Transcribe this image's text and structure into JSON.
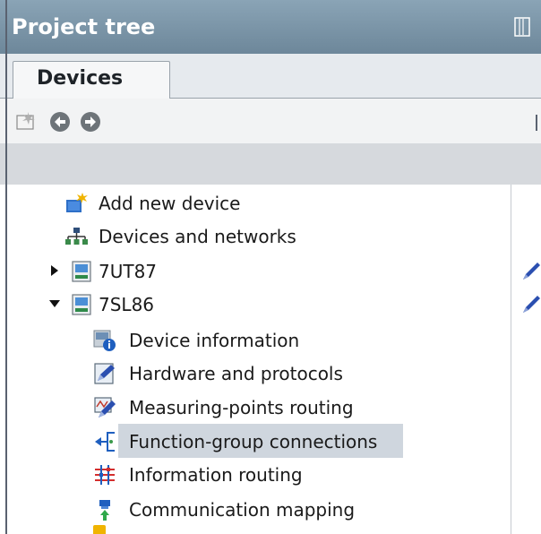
{
  "panel": {
    "title": "Project tree"
  },
  "tabs": [
    {
      "label": "Devices"
    }
  ],
  "toolbar": {
    "buttons": [
      {
        "icon": "new-item-icon"
      },
      {
        "icon": "back-icon"
      },
      {
        "icon": "forward-icon"
      }
    ]
  },
  "tree": {
    "items": [
      {
        "label": "Add new device",
        "icon": "add-device-icon"
      },
      {
        "label": "Devices and networks",
        "icon": "network-icon"
      },
      {
        "label": "7UT87",
        "icon": "device-icon",
        "expanded": false
      },
      {
        "label": "7SL86",
        "icon": "device-icon",
        "expanded": true
      },
      {
        "label": "Device information",
        "icon": "device-info-icon"
      },
      {
        "label": "Hardware and protocols",
        "icon": "hardware-icon"
      },
      {
        "label": "Measuring-points routing",
        "icon": "measuring-icon"
      },
      {
        "label": "Function-group connections",
        "icon": "function-group-icon",
        "selected": true
      },
      {
        "label": "Information routing",
        "icon": "info-routing-icon"
      },
      {
        "label": "Communication mapping",
        "icon": "comm-mapping-icon"
      }
    ]
  },
  "colors": {
    "title_bar": "#7a93a6",
    "selection": "#cfd6de",
    "header_band": "#d6d9dd"
  }
}
